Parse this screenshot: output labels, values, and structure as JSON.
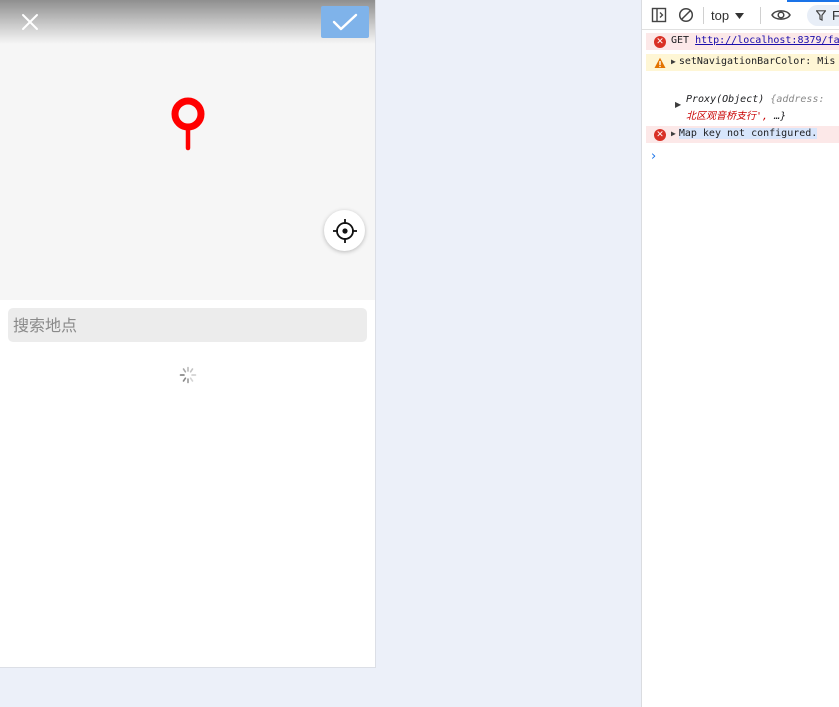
{
  "app": {
    "search": {
      "placeholder": "搜索地点",
      "value": ""
    },
    "icons": {
      "close": "close-icon",
      "confirm": "check-icon",
      "pin": "map-pin-icon",
      "locate": "crosshair-icon",
      "loading": "spinner-icon"
    },
    "colors": {
      "pin": "#ff0000",
      "confirm_bg": "#7fb3ea",
      "search_bg": "#ececec"
    }
  },
  "devtools": {
    "toolbar": {
      "context": "top",
      "filter_label": "F",
      "icons": [
        "dock-sidebar-icon",
        "clear-console-icon",
        "eye-icon",
        "filter-icon"
      ]
    },
    "messages": [
      {
        "level": "error",
        "method": "GET",
        "url": "http://localhost:8379/fa"
      },
      {
        "level": "warn",
        "text": "setNavigationBarColor: Mis"
      },
      {
        "level": "log",
        "line1_prefix": "Proxy(Object)",
        "line1_key": "{address:",
        "line2_value": "北区观音桥支行',",
        "line2_rest": "…}"
      },
      {
        "level": "error",
        "text": "Map key not configured."
      }
    ],
    "prompt": "›"
  }
}
